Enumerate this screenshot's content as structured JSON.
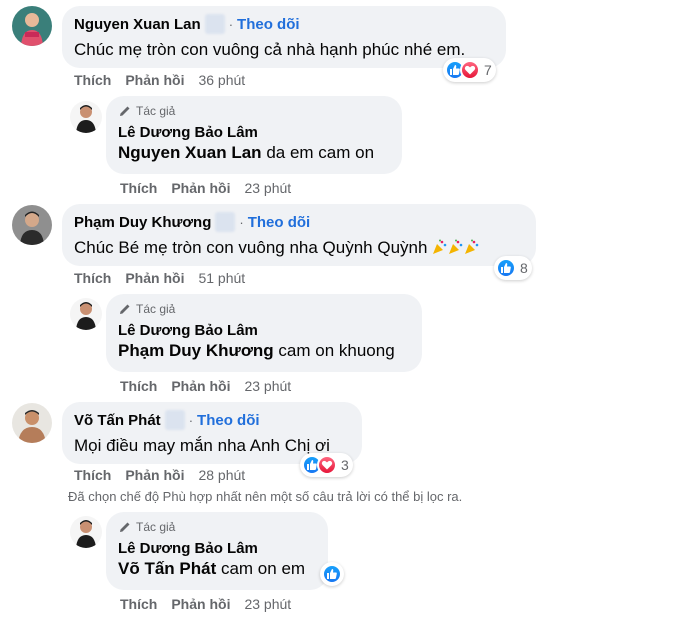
{
  "follow_label": "Theo dõi",
  "like_label": "Thích",
  "reply_label": "Phản hồi",
  "author_label": "Tác giả",
  "comments": [
    {
      "name": "Nguyen Xuan Lan",
      "text": "Chúc mẹ tròn con vuông cả nhà hạnh phúc nhé em.",
      "time": "36 phút",
      "reactions": [
        "like",
        "love"
      ],
      "reaction_count": "7",
      "reply": {
        "name": "Lê Dương Bảo Lâm",
        "mention": "Nguyen Xuan Lan",
        "text": "da em cam on",
        "time": "23 phút"
      }
    },
    {
      "name": "Phạm Duy Khương",
      "text": "Chúc Bé mẹ tròn con vuông nha Quỳnh Quỳnh",
      "time": "51 phút",
      "reactions": [
        "like"
      ],
      "reaction_count": "8",
      "reply": {
        "name": "Lê Dương Bảo Lâm",
        "mention": "Phạm Duy Khương",
        "text": "cam on khuong",
        "time": "23 phút"
      }
    },
    {
      "name": "Võ Tấn Phát",
      "text": "Mọi điều may mắn nha Anh Chị ơi",
      "time": "28 phút",
      "reactions": [
        "like",
        "love"
      ],
      "reaction_count": "3",
      "reply": {
        "name": "Lê Dương Bảo Lâm",
        "mention": "Võ Tấn Phát",
        "text": "cam on em",
        "time": "23 phút"
      }
    }
  ],
  "filter_notice": "Đã chọn chế độ Phù hợp nhất nên một số câu trả lời có thể bị lọc ra.",
  "colors": {
    "bubble": "#f0f2f5",
    "follow": "#216fdb",
    "meta": "#65676b",
    "like": "#1877f2",
    "love": "#e61739"
  },
  "icons": {
    "like": "thumbs-up-icon",
    "love": "heart-icon",
    "author": "pencil-icon",
    "party": "party-popper-icon"
  }
}
